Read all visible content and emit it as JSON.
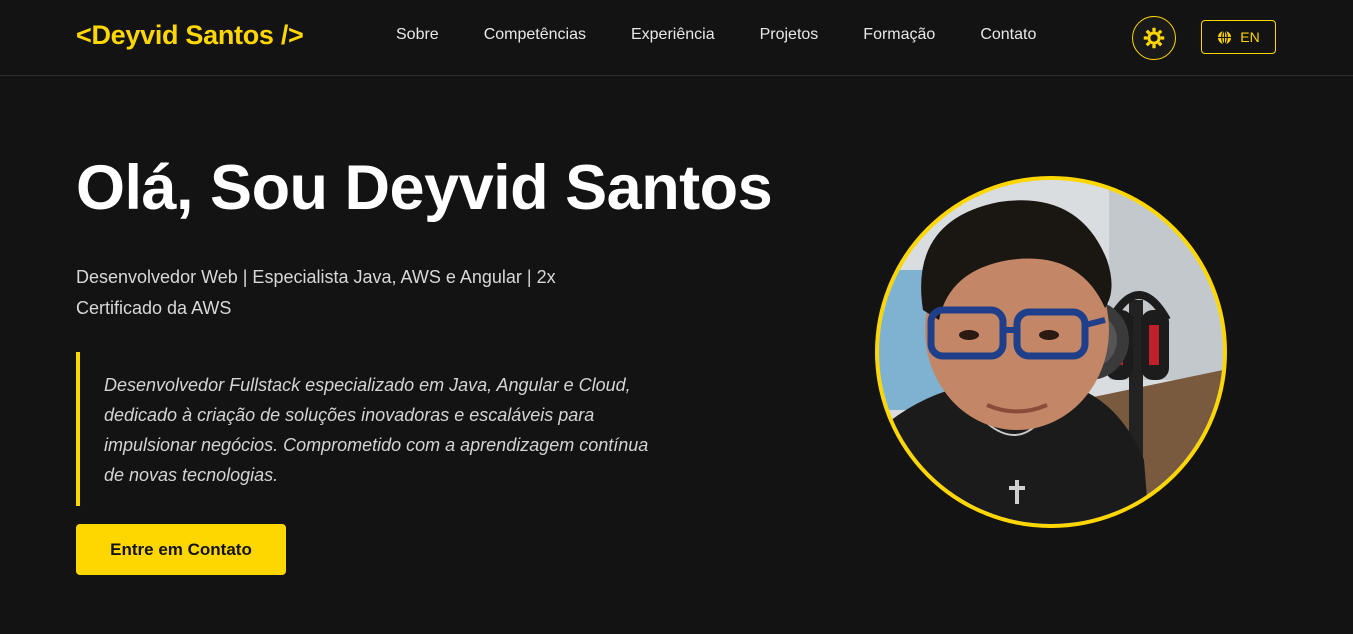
{
  "header": {
    "logo": "<Deyvid Santos />",
    "nav": [
      {
        "label": "Sobre"
      },
      {
        "label": "Competências"
      },
      {
        "label": "Experiência"
      },
      {
        "label": "Projetos"
      },
      {
        "label": "Formação"
      },
      {
        "label": "Contato"
      }
    ],
    "theme_toggle_icon": "sun-icon",
    "language_button": {
      "icon": "globe-icon",
      "label": "EN"
    }
  },
  "hero": {
    "title": "Olá, Sou Deyvid Santos",
    "subtitle": "Desenvolvedor Web | Especialista Java, AWS e Angular | 2x Certificado da AWS",
    "description": "Desenvolvedor Fullstack especializado em Java, Angular e Cloud, dedicado à criação de soluções inovadoras e escaláveis para impulsionar negócios. Comprometido com a aprendizagem contínua de novas tecnologias.",
    "cta_label": "Entre em Contato"
  },
  "colors": {
    "background": "#131313",
    "accent": "#FFD700",
    "text": "#ffffff"
  }
}
